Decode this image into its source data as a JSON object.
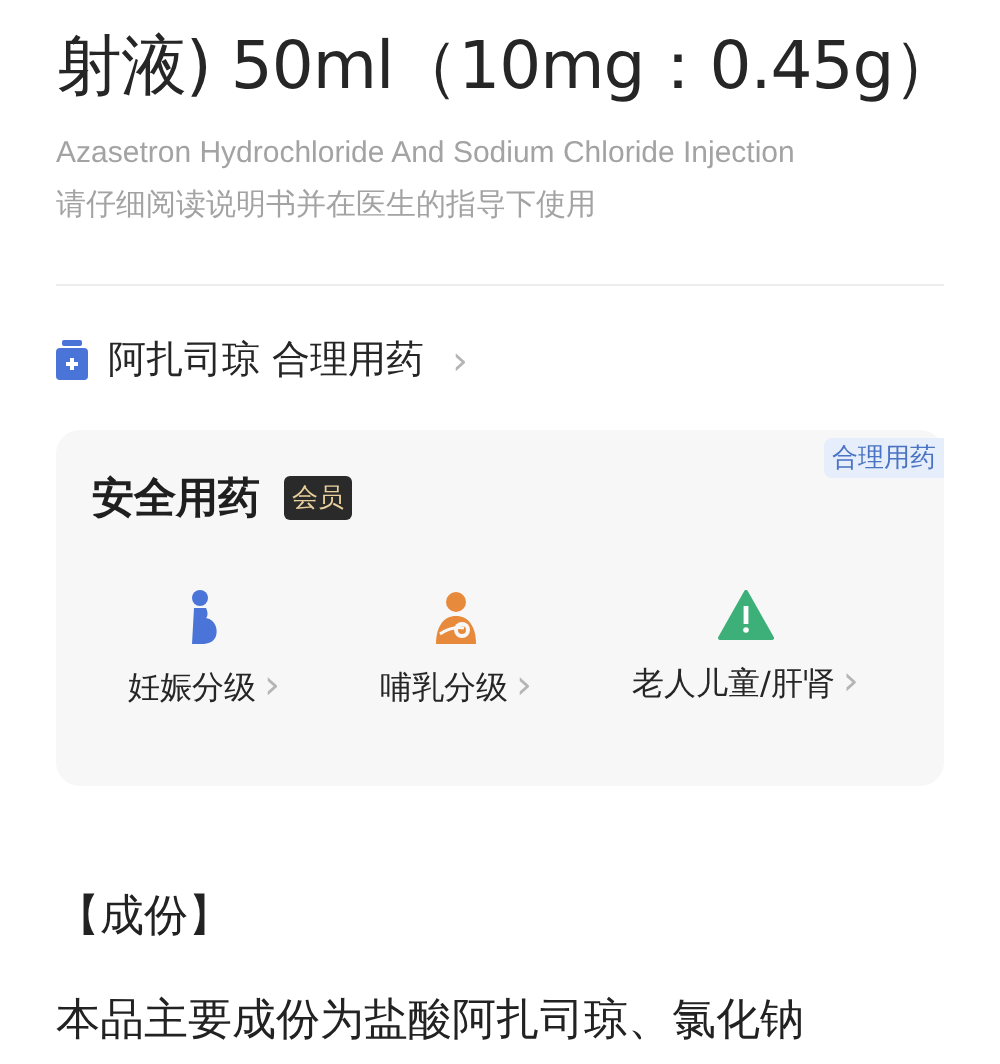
{
  "title": "射液) 50ml（10mg：0.45g）",
  "english_name": "Azasetron Hydrochloride And Sodium Chloride Injection",
  "notice": "请仔细阅读说明书并在医生的指导下使用",
  "drug_link": {
    "label": "阿扎司琼 合理用药",
    "chevron": "›"
  },
  "safety_card": {
    "corner_tag": "合理用药",
    "title": "安全用药",
    "badge": "会员",
    "items": [
      {
        "kind": "pregnancy",
        "label": "妊娠分级",
        "chevron": "›"
      },
      {
        "kind": "lactation",
        "label": "哺乳分级",
        "chevron": "›"
      },
      {
        "kind": "warning",
        "label": "老人儿童/肝肾",
        "chevron": "›"
      }
    ]
  },
  "section": {
    "heading": "【成份】",
    "text": "本品主要成份为盐酸阿扎司琼、氯化钠"
  }
}
